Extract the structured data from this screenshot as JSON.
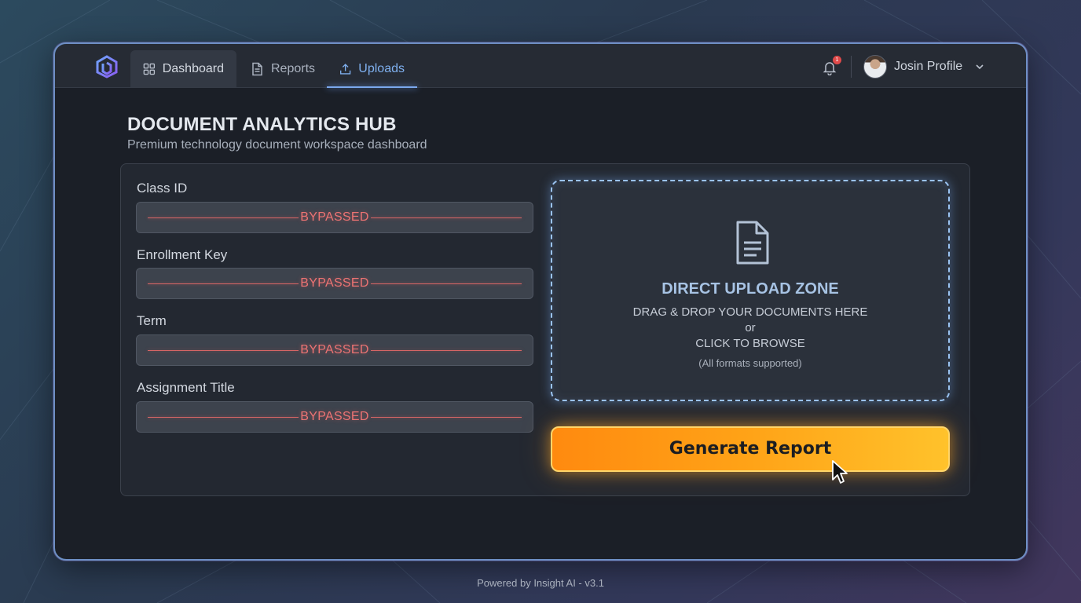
{
  "nav": {
    "items": [
      {
        "label": "Dashboard",
        "icon": "grid-icon"
      },
      {
        "label": "Reports",
        "icon": "document-icon"
      },
      {
        "label": "Uploads",
        "icon": "upload-icon",
        "active": true
      }
    ],
    "notification_count": "1",
    "profile_name": "Josin Profile"
  },
  "header": {
    "title": "DOCUMENT ANALYTICS HUB",
    "subtitle": "Premium technology document workspace dashboard"
  },
  "form": {
    "fields": [
      {
        "label": "Class ID",
        "value": "BYPASSED"
      },
      {
        "label": "Enrollment Key",
        "value": "BYPASSED"
      },
      {
        "label": "Term",
        "value": "BYPASSED"
      },
      {
        "label": "Assignment Title",
        "value": "BYPASSED"
      }
    ]
  },
  "upload": {
    "title": "DIRECT UPLOAD ZONE",
    "line1": "DRAG & DROP YOUR DOCUMENTS HERE",
    "line2": "or",
    "line3": "CLICK TO BROWSE",
    "note": "(All formats supported)"
  },
  "actions": {
    "generate_label": "Generate Report"
  },
  "footer": {
    "text": "Powered by Insight AI - v3.1"
  },
  "colors": {
    "accent": "#7fb0ef",
    "button": "#ffa317",
    "error": "#ec7373"
  }
}
